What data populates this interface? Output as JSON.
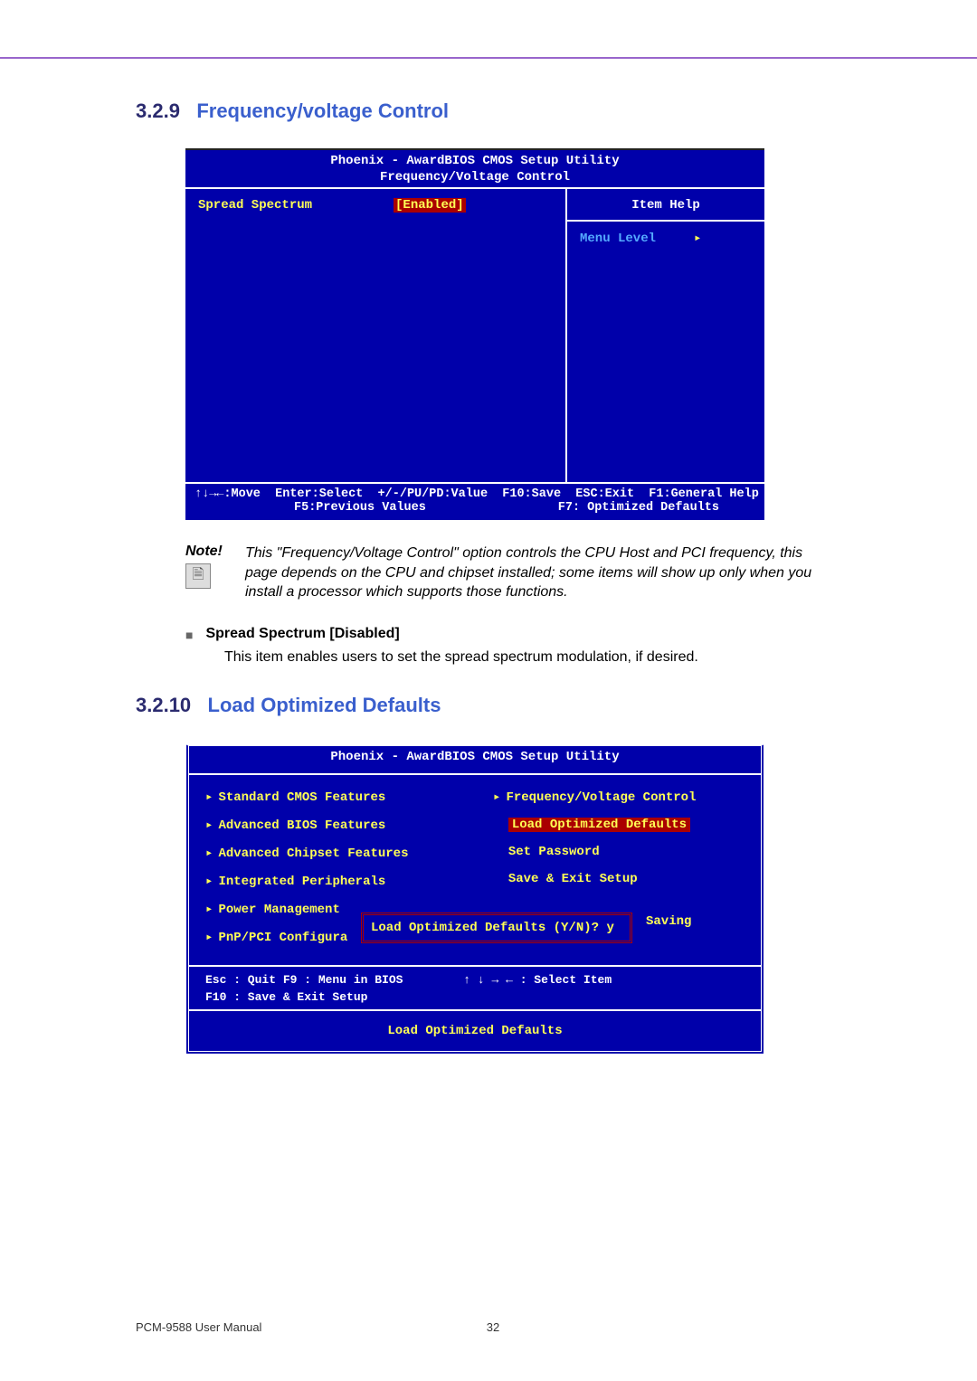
{
  "sections": {
    "s1": {
      "num": "3.2.9",
      "title": "Frequency/voltage Control"
    },
    "s2": {
      "num": "3.2.10",
      "title": "Load Optimized Defaults"
    }
  },
  "bios1": {
    "title_line1": "Phoenix - AwardBIOS CMOS Setup Utility",
    "title_line2": "Frequency/Voltage Control",
    "setting_label": "Spread Spectrum",
    "setting_value": "[Enabled]",
    "help_header": "Item Help",
    "menu_level": "Menu Level",
    "footer_left": "↑↓→←:Move  Enter:Select  +/-/PU/PD:Value  F10:Save  ESC:Exit  F1:General Help",
    "footer_left2": "F5:Previous Values",
    "footer_right2": "F7: Optimized Defaults"
  },
  "note": {
    "label": "Note!",
    "icon_glyph": "🗎",
    "text": "This \"Frequency/Voltage Control\" option controls the CPU Host and PCI frequency, this page depends on the CPU and chipset installed; some items will show up only when you install a processor which supports those functions."
  },
  "bullet": {
    "title": "Spread Spectrum [Disabled]",
    "desc": "This item enables users to set the spread spectrum modulation, if desired."
  },
  "bios2": {
    "title": "Phoenix - AwardBIOS CMOS Setup Utility",
    "left": [
      "Standard CMOS Features",
      "Advanced BIOS Features",
      "Advanced Chipset Features",
      "Integrated Peripherals",
      "Power Management",
      "PnP/PCI Configura"
    ],
    "right": {
      "freq": "Frequency/Voltage Control",
      "load": "Load Optimized Defaults",
      "pwd": "Set Password",
      "save": "Save & Exit Setup",
      "saving_fragment": "Saving"
    },
    "dialog": "Load Optimized Defaults (Y/N)? y",
    "keys_line1_left": "Esc : Quit     F9 : Menu in BIOS",
    "keys_line1_right": "↑ ↓ → ←   : Select Item",
    "keys_line2": "F10 : Save & Exit Setup",
    "bottom": "Load Optimized Defaults"
  },
  "footer": {
    "manual": "PCM-9588 User Manual",
    "page": "32"
  }
}
